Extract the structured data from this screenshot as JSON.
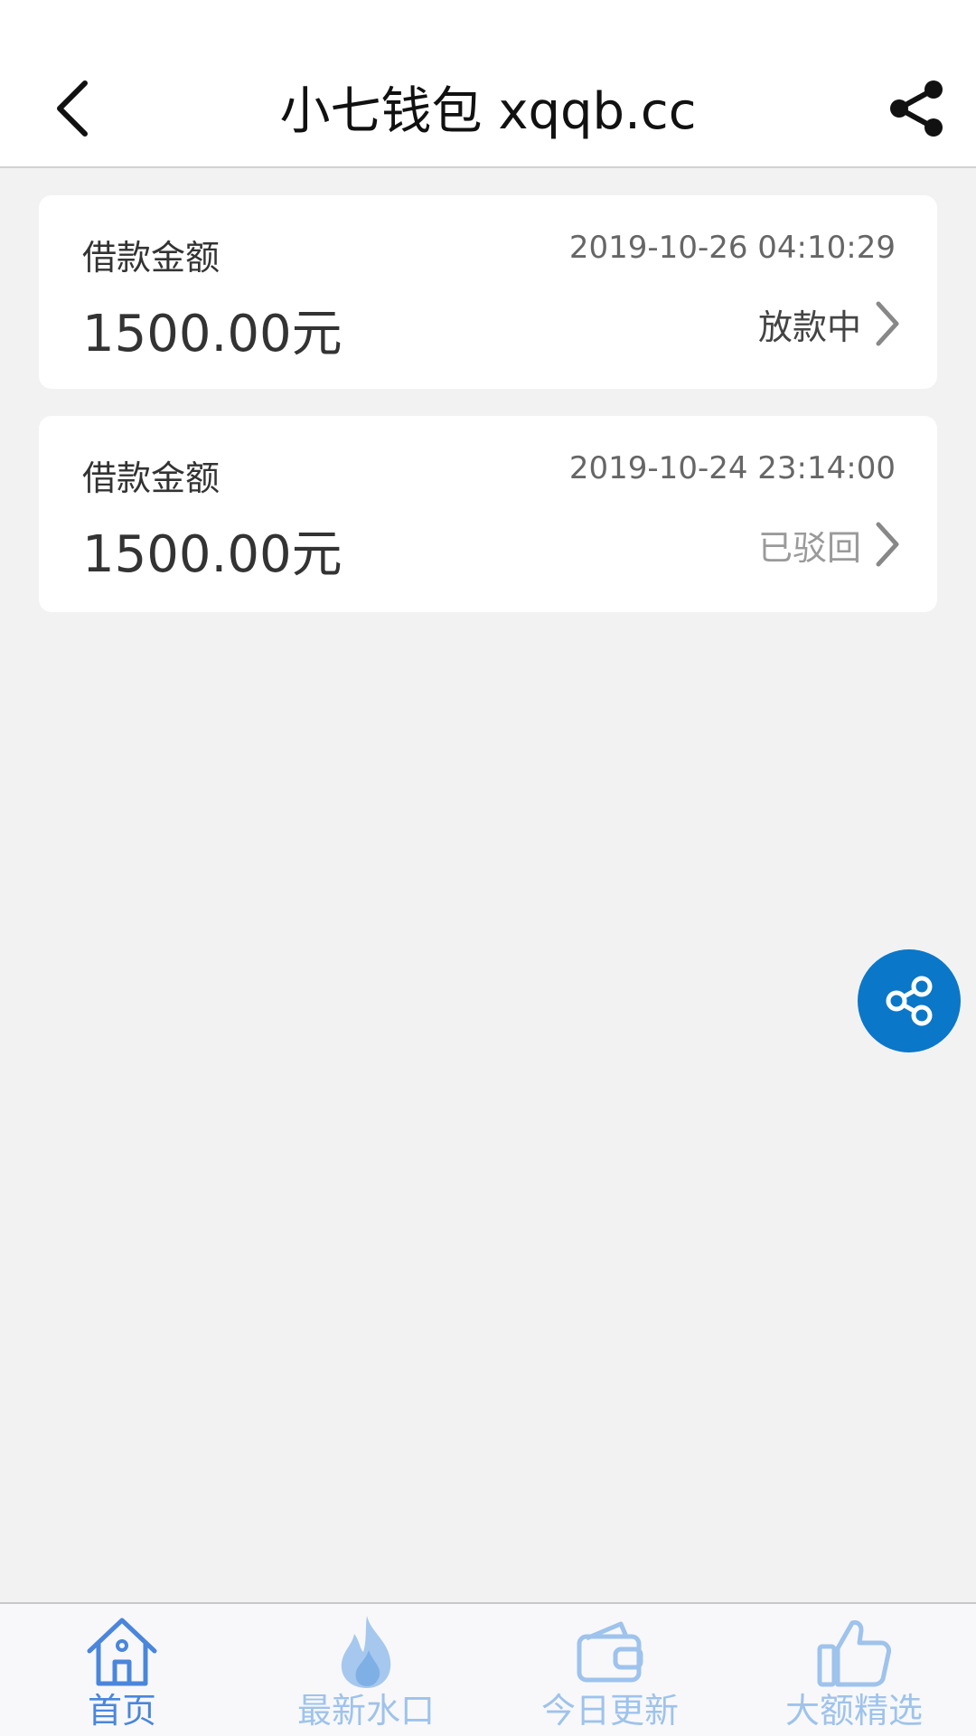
{
  "header": {
    "title": "小七钱包 xqqb.cc"
  },
  "loans": [
    {
      "label": "借款金额",
      "time": "2019-10-26 04:10:29",
      "amount": "1500.00元",
      "status": "放款中"
    },
    {
      "label": "借款金额",
      "time": "2019-10-24 23:14:00",
      "amount": "1500.00元",
      "status": "已驳回"
    }
  ],
  "bottom_nav": {
    "items": [
      {
        "label": "首页",
        "icon": "home-icon"
      },
      {
        "label": "最新水口",
        "icon": "flame-icon"
      },
      {
        "label": "今日更新",
        "icon": "wallet-icon"
      },
      {
        "label": "大额精选",
        "icon": "thumbs-up-icon"
      }
    ]
  },
  "colors": {
    "accent": "#0a77c9",
    "nav_active": "#4a86dc",
    "nav_inactive": "#9ec3ec",
    "status_muted": "#9a9a9a"
  }
}
